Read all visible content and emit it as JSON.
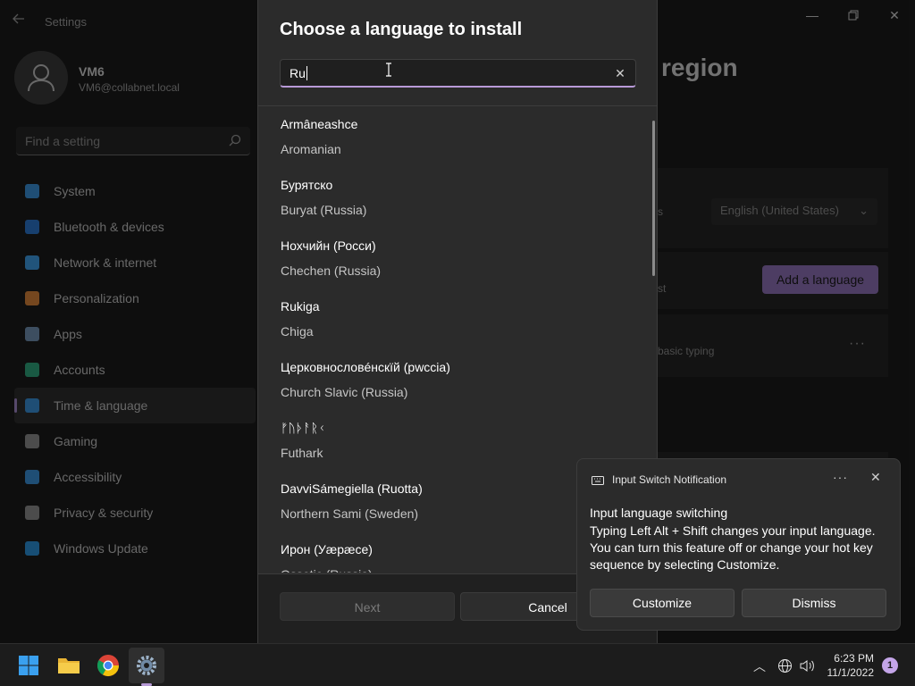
{
  "settings": {
    "app_title": "Settings",
    "user": {
      "name": "VM6",
      "email": "VM6@collabnet.local"
    },
    "search_placeholder": "Find a setting",
    "nav": [
      {
        "label": "System",
        "icon": "system-icon",
        "color": "#3a8fd6"
      },
      {
        "label": "Bluetooth & devices",
        "icon": "bluetooth-icon",
        "color": "#2b74c8"
      },
      {
        "label": "Network & internet",
        "icon": "wifi-icon",
        "color": "#3d9ae0"
      },
      {
        "label": "Personalization",
        "icon": "brush-icon",
        "color": "#d6823a"
      },
      {
        "label": "Apps",
        "icon": "apps-icon",
        "color": "#6f8fb0"
      },
      {
        "label": "Accounts",
        "icon": "person-icon",
        "color": "#2fa37a"
      },
      {
        "label": "Time & language",
        "icon": "globe-clock-icon",
        "color": "#3a8fd6"
      },
      {
        "label": "Gaming",
        "icon": "gamepad-icon",
        "color": "#8a8a8a"
      },
      {
        "label": "Accessibility",
        "icon": "accessibility-icon",
        "color": "#3a8fd6"
      },
      {
        "label": "Privacy & security",
        "icon": "shield-icon",
        "color": "#8a8a8a"
      },
      {
        "label": "Windows Update",
        "icon": "update-icon",
        "color": "#2b8fd6"
      }
    ],
    "active_nav": "Time & language",
    "page_heading_visible": "region",
    "display_language_value": "English (United States)",
    "display_language_suffix": "s",
    "add_language_label": "Add a language",
    "pref_lang_suffix": "st",
    "typing_fragment": "basic typing"
  },
  "dialog": {
    "title": "Choose a language to install",
    "search_value": "Ru",
    "languages": [
      {
        "native": "Armâneashce",
        "english": "Aromanian"
      },
      {
        "native": "Бурятско",
        "english": "Buryat (Russia)"
      },
      {
        "native": "Нохчийн (Росси)",
        "english": "Chechen (Russia)"
      },
      {
        "native": "Rukiga",
        "english": "Chiga"
      },
      {
        "native": "Церковнословéнскїй (рwссiа)",
        "english": "Church Slavic (Russia)"
      },
      {
        "native": "ᚠᚢᚦᚨᚱᚲ",
        "english": "Futhark"
      },
      {
        "native": "DavviSámegiella (Ruotta)",
        "english": "Northern Sami (Sweden)"
      },
      {
        "native": "Ирон (Уæрæсе)",
        "english": "Ossetic (Russia)"
      }
    ],
    "next_label": "Next",
    "cancel_label": "Cancel"
  },
  "toast": {
    "app_name": "Input Switch Notification",
    "title": "Input language switching",
    "body": "Typing Left Alt + Shift changes your input language. You can turn this feature off or change your hot key sequence by selecting Customize.",
    "customize_label": "Customize",
    "dismiss_label": "Dismiss"
  },
  "taskbar": {
    "time": "6:23 PM",
    "date": "11/1/2022",
    "notification_count": "1"
  },
  "colors": {
    "accent": "#b89ad8",
    "dialog_bg": "#2b2b2b",
    "app_bg": "#1b1b1b"
  }
}
